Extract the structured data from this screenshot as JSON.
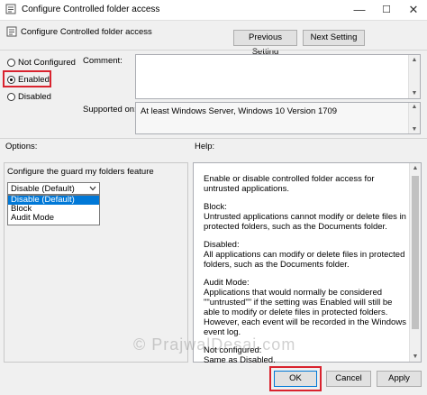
{
  "window": {
    "title": "Configure Controlled folder access",
    "minimize": "—",
    "maximize": "☐",
    "close": "✕"
  },
  "header": {
    "title": "Configure Controlled folder access",
    "previous_button": "Previous Setting",
    "next_button": "Next Setting"
  },
  "state": {
    "options": [
      {
        "label": "Not Configured",
        "selected": false
      },
      {
        "label": "Enabled",
        "selected": true
      },
      {
        "label": "Disabled",
        "selected": false
      }
    ]
  },
  "comment_label": "Comment:",
  "supported": {
    "label": "Supported on:",
    "value": "At least Windows Server, Windows 10 Version 1709"
  },
  "options_label": "Options:",
  "help_label": "Help:",
  "options_panel": {
    "field_label": "Configure the guard my folders feature",
    "select_value": "Disable (Default)",
    "dropdown_items": [
      "Disable (Default)",
      "Block",
      "Audit Mode"
    ],
    "highlighted_index": 0
  },
  "help_text": {
    "p1": "Enable or disable controlled folder access for untrusted applications.",
    "p2a": "Block:",
    "p2b": "Untrusted applications cannot modify or delete files in protected folders, such as the Documents folder.",
    "p3a": "Disabled:",
    "p3b": "All applications can modify or delete files in protected folders, such as the Documents folder.",
    "p4a": "Audit Mode:",
    "p4b": "Applications that would normally be considered \"\"untrusted\"\" if the setting was Enabled will still be able to modify or delete files in protected folders. However, each event will be recorded in the Windows event log.",
    "p5a": "Not configured:",
    "p5b": "Same as Disabled."
  },
  "footer": {
    "ok": "OK",
    "cancel": "Cancel",
    "apply": "Apply"
  },
  "watermark": "© PrajwalDesai.com",
  "colors": {
    "highlight": "#0078d7",
    "annotation_red": "#d9232e"
  }
}
